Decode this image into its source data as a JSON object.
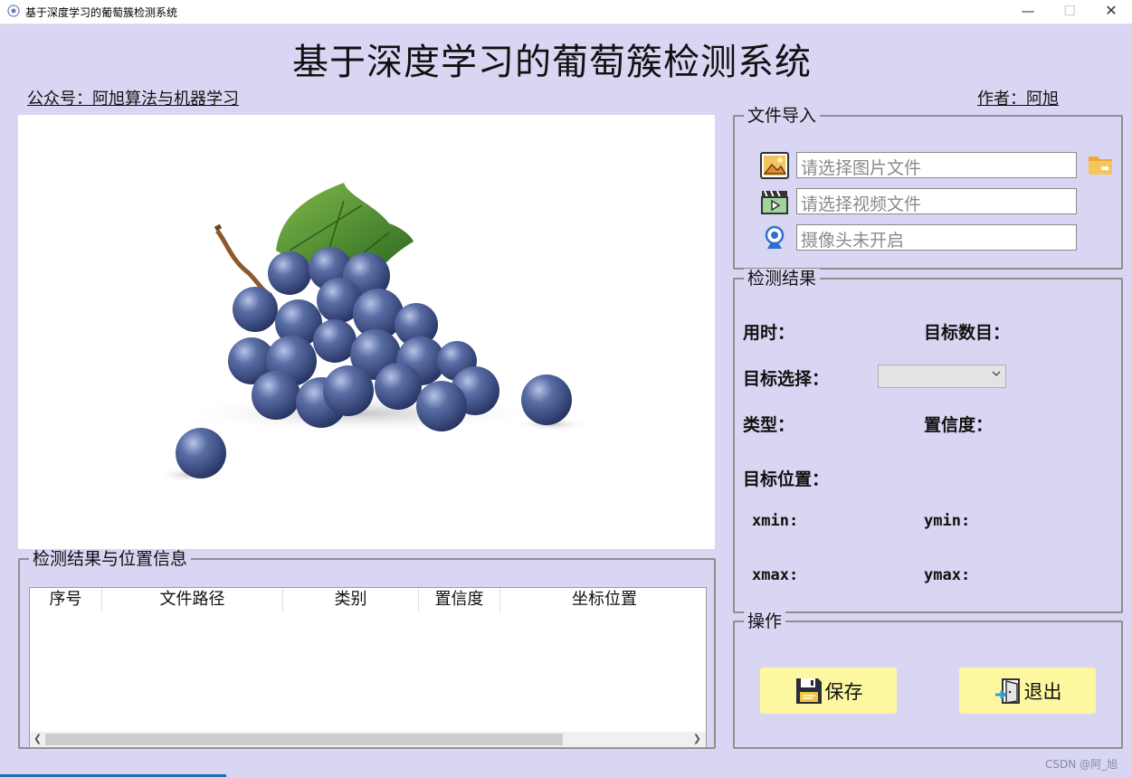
{
  "window": {
    "title": "基于深度学习的葡萄簇检测系统",
    "controls": {
      "minimize": "—",
      "maximize": "☐",
      "close": "✕"
    }
  },
  "header": {
    "title": "基于深度学习的葡萄簇检测系统",
    "public_account": "公众号：阿旭算法与机器学习",
    "author": "作者：阿旭"
  },
  "file_import": {
    "legend": "文件导入",
    "image_placeholder": "请选择图片文件",
    "video_placeholder": "请选择视频文件",
    "camera_placeholder": "摄像头未开启",
    "icons": [
      "image-file-icon",
      "video-file-icon",
      "camera-icon",
      "folder-icon"
    ]
  },
  "results": {
    "legend": "检测结果",
    "time_label": "用时：",
    "count_label": "目标数目：",
    "target_select_label": "目标选择：",
    "type_label": "类型：",
    "confidence_label": "置信度：",
    "position_label": "目标位置：",
    "xmin_label": "xmin:",
    "ymin_label": "ymin:",
    "xmax_label": "xmax:",
    "ymax_label": "ymax:"
  },
  "operations": {
    "legend": "操作",
    "save_label": "保存",
    "exit_label": "退出"
  },
  "table": {
    "legend": "检测结果与位置信息",
    "columns": [
      "序号",
      "文件路径",
      "类别",
      "置信度",
      "坐标位置"
    ]
  },
  "footer": {
    "watermark": "CSDN @阿_旭"
  },
  "colors": {
    "background": "#d8d6f2",
    "button_bg": "#fdf8a0",
    "grape": "#3c4f86",
    "leaf": "#4f8a2c"
  }
}
